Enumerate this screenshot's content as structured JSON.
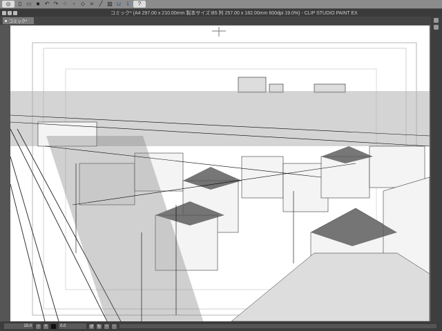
{
  "toolbar": {
    "icons": [
      "clip-studio-icon",
      "new-icon",
      "open-icon",
      "save-icon",
      "undo-icon",
      "redo-icon",
      "transform-icon",
      "clear-icon",
      "fill-icon",
      "crop-icon",
      "ruler-icon",
      "snap-ruler-icon",
      "snap-grid-icon",
      "help-icon"
    ]
  },
  "titlebar": {
    "title": "コミック* (A4 297.00 x 210.00mm 製本サイズ:B5 判 257.00 x 182.00mm 600dpi 19.0%) - CLIP STUDIO PAINT EX"
  },
  "tabs": [
    {
      "label": "コミック*"
    }
  ],
  "status": {
    "zoom": "19.0",
    "rotation": "0.0"
  },
  "colors": {
    "toolbar": "#8c8c8c",
    "titlebar": "#3a3a3a",
    "accent": "#1a4d9e"
  }
}
